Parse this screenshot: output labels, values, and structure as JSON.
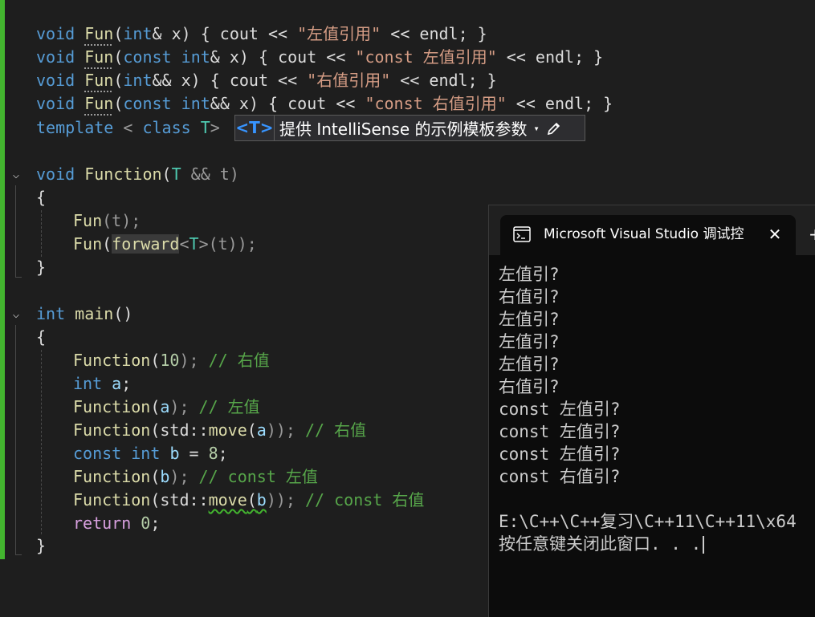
{
  "editor": {
    "lines": [
      {
        "p": [
          "void",
          " ",
          "Fun",
          "(",
          "int",
          "& x) { cout << ",
          "\"左值引用\"",
          " << endl; }"
        ]
      },
      {
        "p": [
          "void",
          " ",
          "Fun",
          "(",
          "const",
          " ",
          "int",
          "& x) { cout << ",
          "\"const 左值引用\"",
          " << endl; }"
        ]
      },
      {
        "p": [
          "void",
          " ",
          "Fun",
          "(",
          "int",
          "&& x) { cout << ",
          "\"右值引用\"",
          " << endl; }"
        ]
      },
      {
        "p": [
          "void",
          " ",
          "Fun",
          "(",
          "const",
          " ",
          "int",
          "&& x) { cout << ",
          "\"const 右值引用\"",
          " << endl; }"
        ]
      },
      {
        "p": [
          "template",
          " < ",
          "class",
          " ",
          "T",
          ">"
        ]
      },
      {
        "p": [
          "void",
          " ",
          "Function",
          "(",
          "T",
          " && t)"
        ]
      },
      {
        "p": [
          "{"
        ]
      },
      {
        "p": [
          "Fun",
          "(t);"
        ]
      },
      {
        "p": [
          "Fun",
          "(",
          "forward",
          "<",
          "T",
          ">(t));"
        ]
      },
      {
        "p": [
          "}"
        ]
      },
      {
        "p": [
          "int",
          " ",
          "main",
          "()"
        ]
      },
      {
        "p": [
          "{"
        ]
      },
      {
        "p": [
          "Function",
          "(",
          "10",
          "); ",
          "// 右值"
        ]
      },
      {
        "p": [
          "int",
          " ",
          "a",
          ";"
        ]
      },
      {
        "p": [
          "Function",
          "(",
          "a",
          "); ",
          "// 左值"
        ]
      },
      {
        "p": [
          "Function",
          "(std::",
          "move",
          "(",
          "a",
          ")); ",
          "// 右值"
        ]
      },
      {
        "p": [
          "const",
          " ",
          "int",
          " ",
          "b",
          " = ",
          "8",
          ";"
        ]
      },
      {
        "p": [
          "Function",
          "(",
          "b",
          "); ",
          "// const 左值"
        ]
      },
      {
        "p": [
          "Function",
          "(std::",
          "move",
          "(",
          "b",
          ")); ",
          "// const 右值"
        ]
      },
      {
        "p": [
          "return",
          " ",
          "0",
          ";"
        ]
      },
      {
        "p": [
          "}"
        ]
      }
    ]
  },
  "intellisense_tip": {
    "tag": "<T>",
    "text": "提供 IntelliSense 的示例模板参数",
    "caret": "▾"
  },
  "console": {
    "tab_title": "Microsoft Visual Studio 调试控制台",
    "close_glyph": "✕",
    "new_tab_glyph": "+",
    "output": [
      "左值引?",
      "右值引?",
      "左值引?",
      "左值引?",
      "左值引?",
      "右值引?",
      "const 左值引?",
      "const 左值引?",
      "const 左值引?",
      "const 右值引?",
      "",
      "E:\\C++\\C++复习\\C++11\\C++11\\x64",
      "按任意键关闭此窗口. . ."
    ]
  },
  "colors": {
    "editor_bg": "#1e1e1e",
    "keyword": "#569cd6",
    "function": "#dcdcaa",
    "type_param": "#4ec9b0",
    "string": "#d69d85",
    "number": "#b5cea8",
    "comment": "#57a64a",
    "change_bar": "#43b52f",
    "console_bg": "#0c0c0c"
  }
}
